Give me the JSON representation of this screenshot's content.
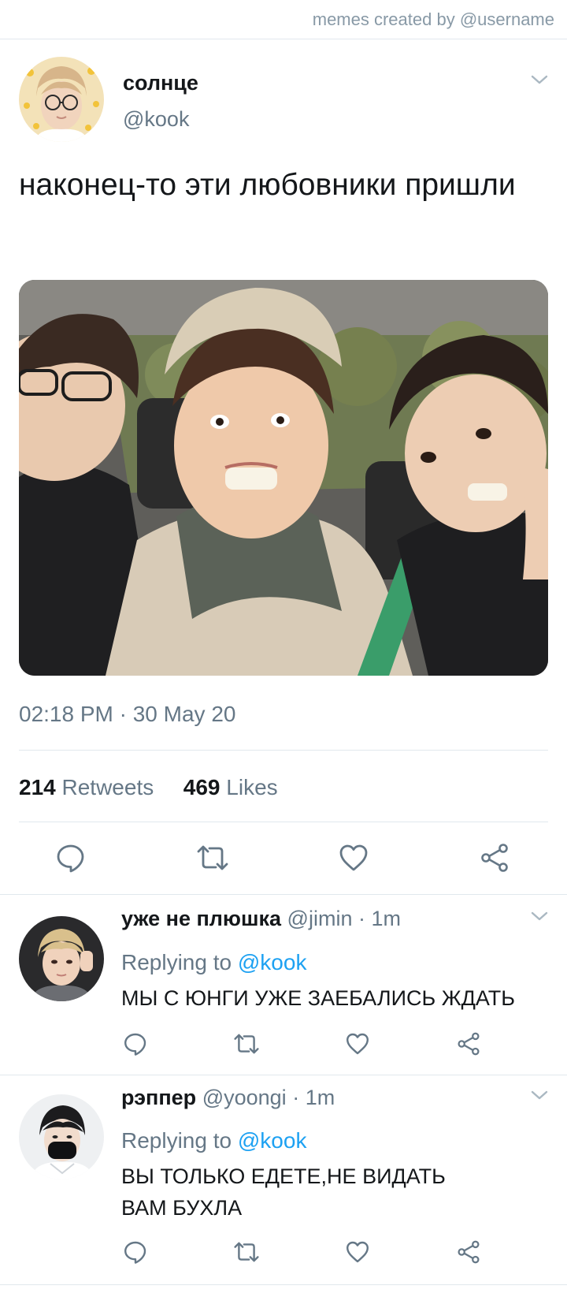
{
  "watermark": "memes created by @username",
  "tweet": {
    "display_name": "солнце",
    "handle": "@kook",
    "text": "наконец-то эти любовники пришли",
    "timestamp": "02:18 PM · 30 May 20",
    "retweets_count": "214",
    "retweets_label": "Retweets",
    "likes_count": "469",
    "likes_label": "Likes"
  },
  "replies": [
    {
      "name": "уже не плюшка",
      "handle": "@jimin",
      "time": "1m",
      "replying_label": "Replying to",
      "replying_to": "@kook",
      "text": "МЫ С ЮНГИ УЖЕ ЗАЕБАЛИСЬ ЖДАТЬ"
    },
    {
      "name": "рэппер",
      "handle": "@yoongi",
      "time": "1m",
      "replying_label": "Replying to",
      "replying_to": "@kook",
      "text": "ВЫ ТОЛЬКО ЕДЕТЕ,НЕ ВИДАТЬ ВАМ БУХЛА"
    }
  ],
  "colors": {
    "text": "#14171a",
    "secondary": "#657786",
    "link": "#1da1f2",
    "divider": "#e1e8ed",
    "icon": "#657786"
  },
  "icons": [
    "reply-icon",
    "retweet-icon",
    "like-icon",
    "share-icon",
    "chevron-down-icon"
  ]
}
